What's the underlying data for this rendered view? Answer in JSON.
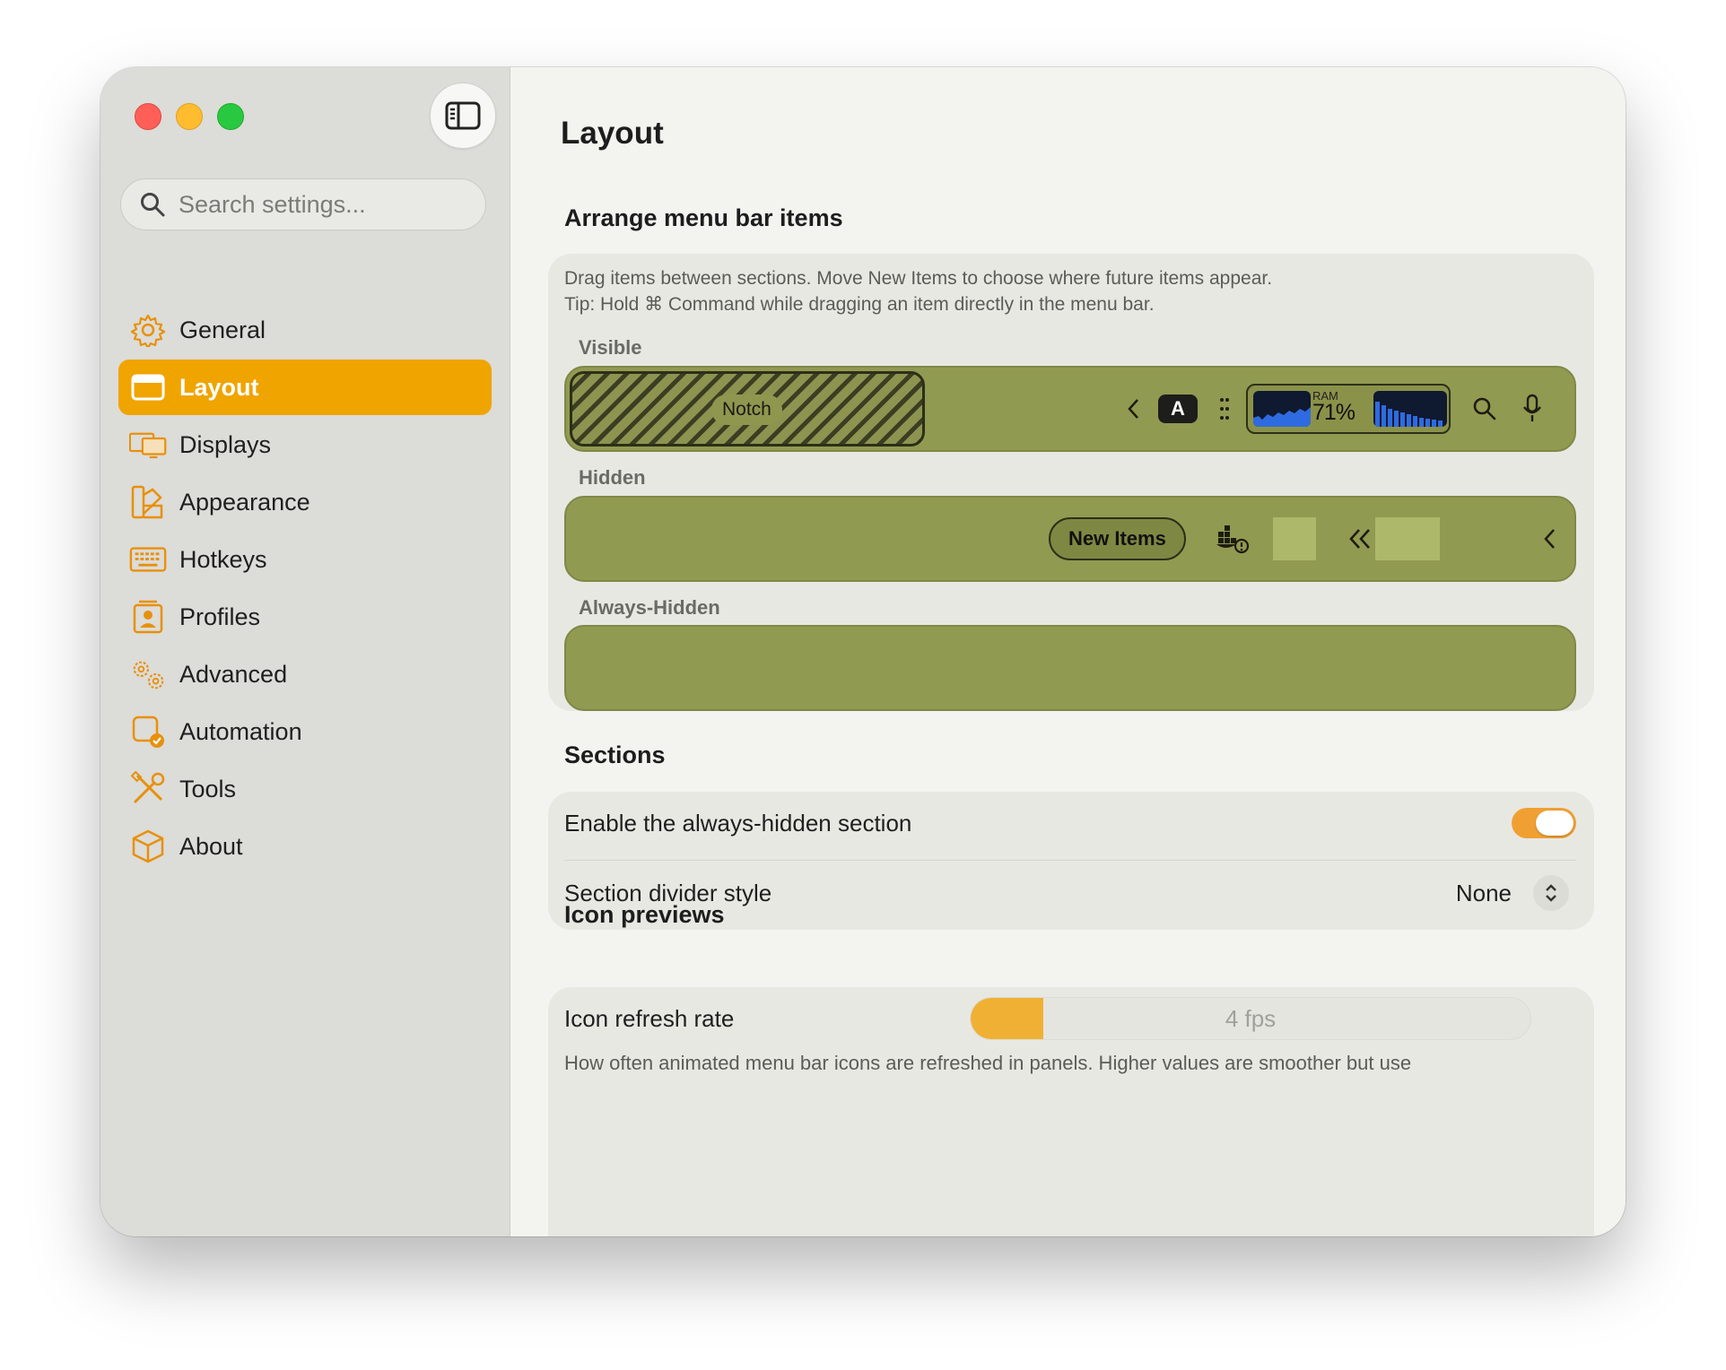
{
  "sidebar": {
    "search_placeholder": "Search settings...",
    "items": [
      {
        "label": "General",
        "icon": "gear-icon"
      },
      {
        "label": "Layout",
        "icon": "layout-icon",
        "active": true
      },
      {
        "label": "Displays",
        "icon": "displays-icon"
      },
      {
        "label": "Appearance",
        "icon": "appearance-icon"
      },
      {
        "label": "Hotkeys",
        "icon": "keyboard-icon"
      },
      {
        "label": "Profiles",
        "icon": "profile-icon"
      },
      {
        "label": "Advanced",
        "icon": "gears-icon"
      },
      {
        "label": "Automation",
        "icon": "automation-icon"
      },
      {
        "label": "Tools",
        "icon": "tools-icon"
      },
      {
        "label": "About",
        "icon": "cube-icon"
      }
    ]
  },
  "main": {
    "title": "Layout",
    "arrange": {
      "heading": "Arrange menu bar items",
      "desc1": "Drag items between sections. Move New Items to choose where future items appear.",
      "desc2": "Tip: Hold ⌘ Command while dragging an item directly in the menu bar.",
      "visible_label": "Visible",
      "hidden_label": "Hidden",
      "always_hidden_label": "Always-Hidden",
      "notch_label": "Notch",
      "a_badge": "A",
      "ram_label": "RAM",
      "ram_value": "71%",
      "new_items_label": "New Items"
    },
    "sections": {
      "heading": "Sections",
      "always_hidden_label": "Enable the always-hidden section",
      "always_hidden_enabled": true,
      "divider_label": "Section divider style",
      "divider_value": "None"
    },
    "icon_previews": {
      "heading": "Icon previews",
      "refresh_label": "Icon refresh rate",
      "refresh_value": "4 fps",
      "refresh_fraction": 0.13,
      "refresh_desc": "How often animated menu bar icons are refreshed in panels. Higher values are smoother but use"
    }
  },
  "colors": {
    "accent": "#f0a400",
    "menubar": "#919a51"
  }
}
